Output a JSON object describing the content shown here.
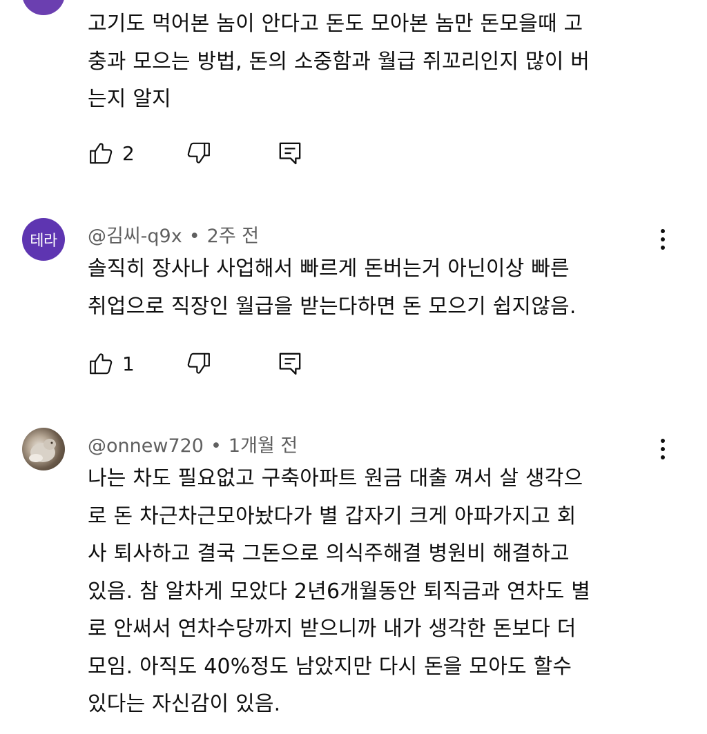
{
  "comments": [
    {
      "text": "고기도 먹어본 놈이 안다고 돈도 모아본 놈만 돈모을때 고\n충과 모으는 방법, 돈의 소중함과 월급 쥐꼬리인지 많이 버\n는지 알지",
      "likes": "2",
      "icons": {
        "like": "thumbs-up-icon",
        "dislike": "thumbs-down-icon",
        "reply": "reply-icon"
      }
    },
    {
      "avatar_text": "테라",
      "author": "@김씨-q9x",
      "separator": "•",
      "time": "2주 전",
      "text": "솔직히 장사나 사업해서 빠르게 돈버는거 아닌이상 빠른\n취업으로 직장인 월급을 받는다하면 돈 모으기 쉽지않음.",
      "likes": "1",
      "avatar_color": "#5e35b1"
    },
    {
      "author": "@onnew720",
      "separator": "•",
      "time": "1개월 전",
      "text": "나는 차도 필요없고 구축아파트 원금 대출 껴서 살 생각으\n로 돈 차근차근모아놨다가 별 갑자기 크게 아파가지고 회\n사 퇴사하고 결국 그돈으로 의식주해결 병원비 해결하고\n있음. 참 알차게 모았다 2년6개월동안 퇴직금과 연차도 별\n로 안써서 연차수당까지 받으니까 내가 생각한 돈보다 더\n모임. 아직도 40%정도 남았지만 다시 돈을 모아도 할수\n있다는 자신감이 있음."
    }
  ]
}
